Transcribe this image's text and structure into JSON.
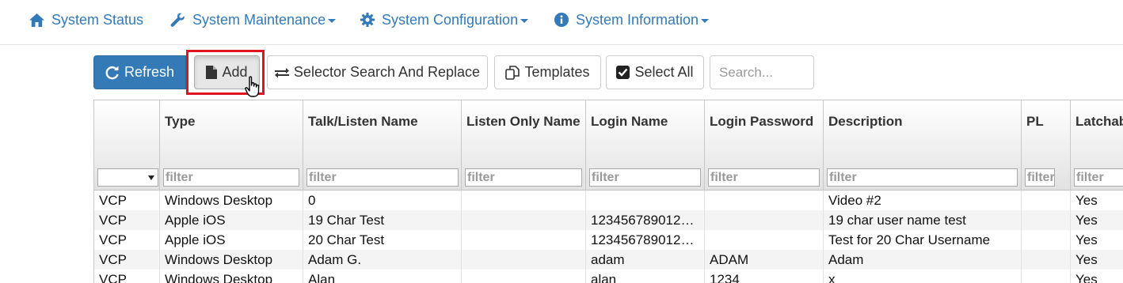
{
  "nav": {
    "status": "System Status",
    "maintenance": "System Maintenance",
    "configuration": "System Configuration",
    "information": "System Information"
  },
  "toolbar": {
    "refresh": "Refresh",
    "add": "Add",
    "selector_replace": "Selector Search And Replace",
    "templates": "Templates",
    "select_all": "Select All",
    "search_placeholder": "Search..."
  },
  "grid": {
    "columns": [
      "",
      "Type",
      "Talk/Listen Name",
      "Listen Only Name",
      "Login Name",
      "Login Password",
      "Description",
      "PL",
      "Latchab"
    ],
    "filter_placeholder": "filter",
    "rows": [
      [
        "VCP",
        "Windows Desktop",
        "0",
        "",
        "",
        "",
        "Video #2",
        "",
        "Yes"
      ],
      [
        "VCP",
        "Apple iOS",
        "19 Char Test",
        "",
        "123456789012…",
        "",
        "19 char user name test",
        "",
        "Yes"
      ],
      [
        "VCP",
        "Apple iOS",
        "20 Char Test",
        "",
        "123456789012…",
        "",
        "Test for 20 Char Username",
        "",
        "Yes"
      ],
      [
        "VCP",
        "Windows Desktop",
        "Adam G.",
        "",
        "adam",
        "ADAM",
        "Adam",
        "",
        "Yes"
      ],
      [
        "VCP",
        "Windows Desktop",
        "Alan",
        "",
        "alan",
        "1234",
        "x",
        "",
        "Yes"
      ]
    ]
  },
  "colors": {
    "link": "#337ab7",
    "primary": "#337ab7",
    "highlight": "#e0141e"
  }
}
